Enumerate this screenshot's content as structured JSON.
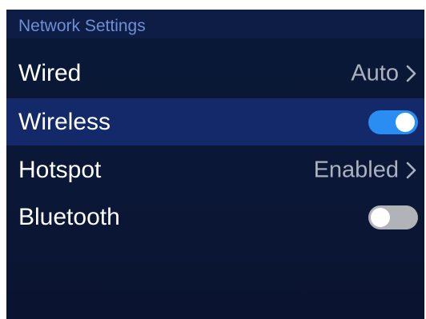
{
  "header": {
    "title": "Network Settings"
  },
  "settings": {
    "wired": {
      "label": "Wired",
      "value": "Auto",
      "chevron_icon": "chevron-right-icon"
    },
    "wireless": {
      "label": "Wireless",
      "toggle": "on"
    },
    "hotspot": {
      "label": "Hotspot",
      "value": "Enabled",
      "chevron_icon": "chevron-right-icon"
    },
    "bluetooth": {
      "label": "Bluetooth",
      "toggle": "off"
    }
  },
  "colors": {
    "background": "#0b1736",
    "header_text": "#6f8fd4",
    "selected_row": "#13296a",
    "toggle_on": "#2a8df2",
    "toggle_off": "#b0b3b8",
    "value_text": "#aab1bf"
  }
}
